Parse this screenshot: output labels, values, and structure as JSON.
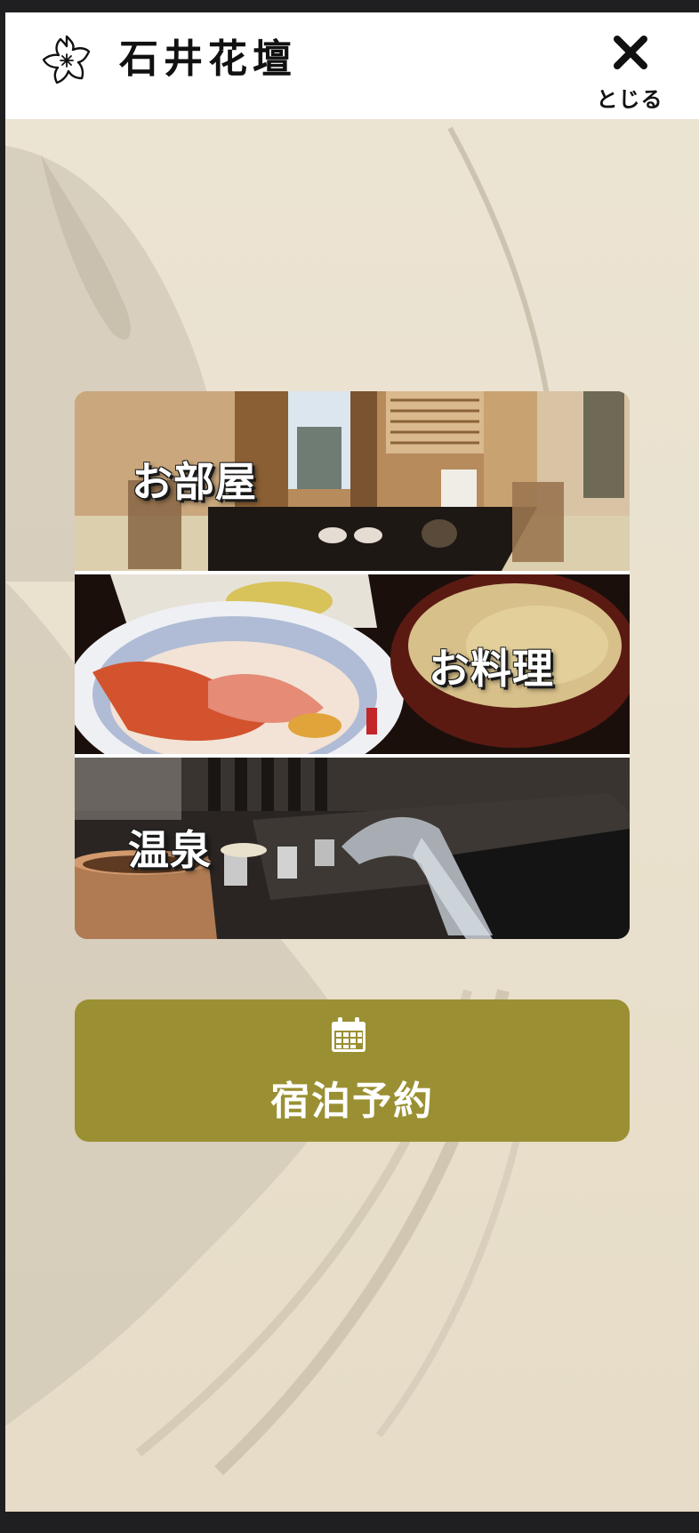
{
  "header": {
    "logo_text": "石井花壇",
    "close_label": "とじる"
  },
  "menu": {
    "items": [
      {
        "label": "お部屋",
        "image": "guest-room-photo"
      },
      {
        "label": "お料理",
        "image": "cuisine-photo"
      },
      {
        "label": "温泉",
        "image": "hot-spring-photo"
      }
    ]
  },
  "reserve": {
    "label": "宿泊予約",
    "icon": "calendar-icon"
  },
  "colors": {
    "header_bg": "#ffffff",
    "page_bg": "#e9e0cd",
    "reserve_bg": "#9a9033",
    "text_dark": "#111111"
  }
}
